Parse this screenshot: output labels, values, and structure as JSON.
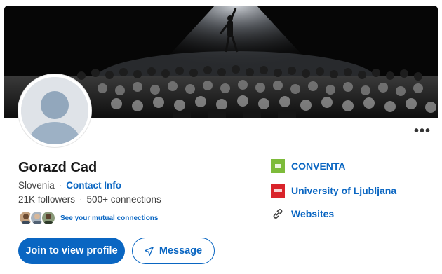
{
  "profile": {
    "name": "Gorazd Cad",
    "location": "Slovenia",
    "contact_link": "Contact Info",
    "followers": "21K followers",
    "connections": "500+ connections",
    "mutual_text": "See your mutual connections"
  },
  "actions": {
    "primary_label": "Join to view profile",
    "secondary_label": "Message",
    "more_label": "•••"
  },
  "sidebar": {
    "items": [
      {
        "label": "CONVENTA",
        "icon": "conventa-logo"
      },
      {
        "label": "University of Ljubljana",
        "icon": "university-logo"
      },
      {
        "label": "Websites",
        "icon": "link-icon"
      }
    ]
  },
  "colors": {
    "brand_blue": "#0a66c2",
    "conventa_green": "#7dbb3a",
    "university_red": "#d9232a"
  }
}
